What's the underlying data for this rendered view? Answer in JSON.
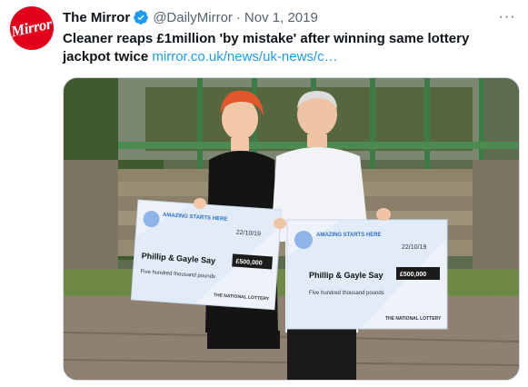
{
  "account": {
    "avatar_text": "Mirror",
    "display_name": "The Mirror",
    "handle": "@DailyMirror",
    "separator": "·",
    "date": "Nov 1, 2019",
    "verified": true
  },
  "tweet": {
    "text": "Cleaner reaps £1million 'by mistake' after winning same lottery jackpot twice",
    "link": "mirror.co.uk/news/uk-news/c…"
  },
  "photo": {
    "cheque_left": {
      "date": "22/10/19",
      "payee": "Phillip & Gayle Say",
      "amount": "£500,000",
      "amount_words": "Five hundred thousand pounds",
      "slogan": "AMAZING STARTS HERE",
      "brand": "THE NATIONAL LOTTERY"
    },
    "cheque_right": {
      "date": "22/10/19",
      "payee": "Phillip & Gayle Say",
      "amount": "£500,000",
      "amount_words": "Five hundred thousand pounds",
      "slogan": "AMAZING STARTS HERE",
      "brand": "THE NATIONAL LOTTERY"
    }
  },
  "colors": {
    "brand_red": "#e2001a",
    "link_blue": "#1d9bf0",
    "verified_blue": "#1d9bf0"
  }
}
